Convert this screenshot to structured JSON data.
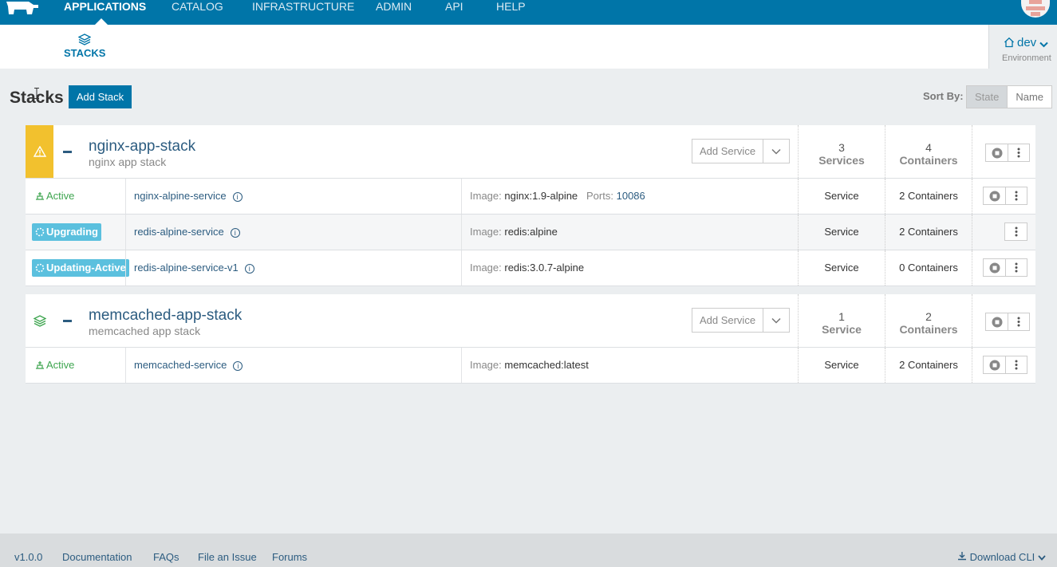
{
  "nav": {
    "items": [
      "APPLICATIONS",
      "CATALOG",
      "INFRASTRUCTURE",
      "ADMIN",
      "API",
      "HELP"
    ],
    "active": "APPLICATIONS"
  },
  "subnav": {
    "tab": "STACKS"
  },
  "environment": {
    "name": "dev",
    "label": "Environment"
  },
  "page": {
    "title": "Stacks",
    "add_stack": "Add Stack",
    "sort_label": "Sort By:",
    "sort_options": [
      "State",
      "Name"
    ],
    "sort_active": "State"
  },
  "stacks": [
    {
      "name": "nginx-app-stack",
      "description": "nginx app stack",
      "state_icon": "warning-icon",
      "add_service": "Add Service",
      "services_count": "3",
      "services_label": "Services",
      "containers_count": "4",
      "containers_label": "Containers",
      "services": [
        {
          "state": "Active",
          "name": "nginx-alpine-service",
          "image_label": "Image:",
          "image": "nginx:1.9-alpine",
          "ports_label": "Ports:",
          "ports": "10086",
          "kind": "Service",
          "containers": "2 Containers"
        },
        {
          "state": "Upgrading",
          "name": "redis-alpine-service",
          "image_label": "Image:",
          "image": "redis:alpine",
          "kind": "Service",
          "containers": "2 Containers"
        },
        {
          "state": "Updating-Active",
          "name": "redis-alpine-service-v1",
          "image_label": "Image:",
          "image": "redis:3.0.7-alpine",
          "kind": "Service",
          "containers": "0 Containers"
        }
      ]
    },
    {
      "name": "memcached-app-stack",
      "description": "memcached app stack",
      "state_icon": "layers-icon",
      "add_service": "Add Service",
      "services_count": "1",
      "services_label": "Service",
      "containers_count": "2",
      "containers_label": "Containers",
      "services": [
        {
          "state": "Active",
          "name": "memcached-service",
          "image_label": "Image:",
          "image": "memcached:latest",
          "kind": "Service",
          "containers": "2 Containers"
        }
      ]
    }
  ],
  "footer": {
    "version": "v1.0.0",
    "links": [
      "Documentation",
      "FAQs",
      "File an Issue",
      "Forums"
    ],
    "download": "Download CLI"
  },
  "colors": {
    "brand": "#0075a8",
    "warning": "#f2c12e",
    "active": "#3ea54f",
    "badge": "#5bc0de"
  }
}
